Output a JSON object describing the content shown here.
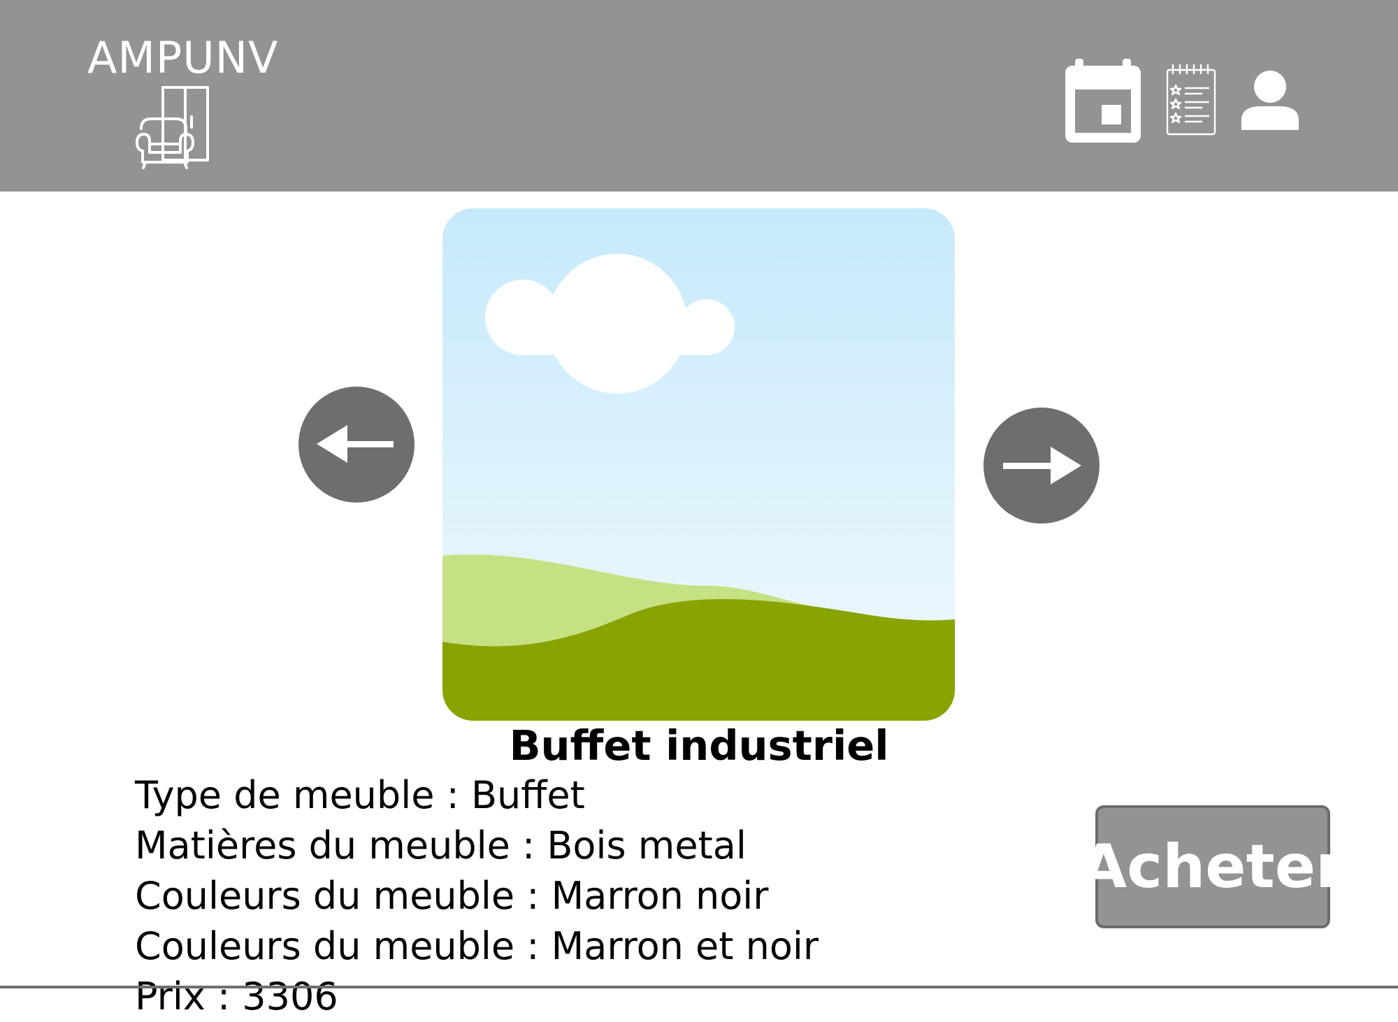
{
  "brand": {
    "name": "AMPUNV",
    "logo_icon": "furniture-armchair-wardrobe-icon"
  },
  "header": {
    "icons": [
      "calendar-icon",
      "reviews-notepad-icon",
      "user-profile-icon"
    ],
    "background": "#939393"
  },
  "carousel": {
    "image_icon": "landscape-placeholder-image",
    "prev_icon": "arrow-left-icon",
    "next_icon": "arrow-right-icon"
  },
  "product": {
    "title": "Buffet industriel",
    "specs": [
      "Type de meuble : Buffet",
      "Matières du meuble : Bois metal",
      "Couleurs du meuble : Marron noir",
      "Couleurs du meuble : Marron et noir",
      "Prix : 3306"
    ]
  },
  "actions": {
    "buy_label": "Acheter"
  },
  "colors": {
    "header": "#939393",
    "nav_button": "#6e6e6e",
    "buy_border": "#6b6b6b"
  }
}
